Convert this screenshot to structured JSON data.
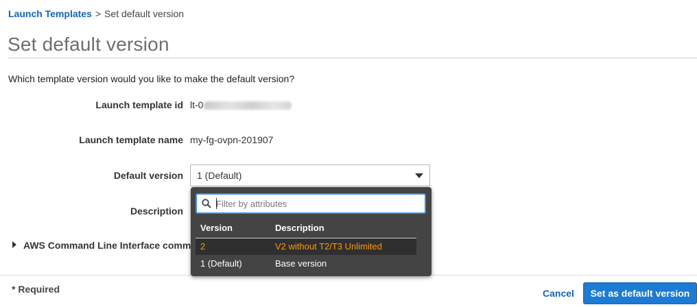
{
  "breadcrumb": {
    "parent": "Launch Templates",
    "separator": ">",
    "current": "Set default version"
  },
  "page_title": "Set default version",
  "question": "Which template version would you like to make the default version?",
  "form": {
    "template_id_label": "Launch template id",
    "template_id_prefix": "lt-0",
    "template_name_label": "Launch template name",
    "template_name_value": "my-fg-ovpn-201907",
    "default_version_label": "Default version",
    "default_version_selected": "1 (Default)",
    "description_label": "Description"
  },
  "dropdown": {
    "filter_placeholder": "Filter by attributes",
    "columns": [
      "Version",
      "Description"
    ],
    "rows": [
      {
        "version": "2",
        "description": "V2 without T2/T3 Unlimited",
        "highlighted": true
      },
      {
        "version": "1 (Default)",
        "description": "Base version",
        "highlighted": false
      }
    ]
  },
  "cli_section": "AWS Command Line Interface comm",
  "footer": {
    "required_note": "* Required",
    "cancel_label": "Cancel",
    "submit_label": "Set as default version"
  },
  "colors": {
    "link": "#1166bb",
    "primary_button": "#1c7bd4",
    "dropdown_bg": "#444444",
    "highlight_text": "#ff9900"
  }
}
